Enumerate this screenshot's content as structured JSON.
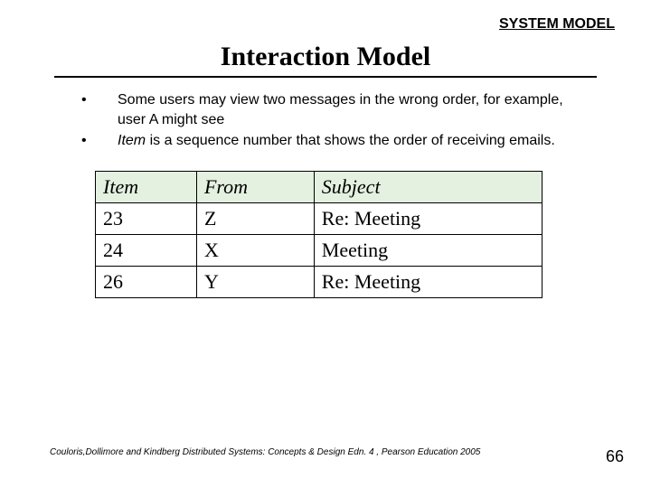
{
  "header": "SYSTEM MODEL",
  "title": "Interaction Model",
  "bullets": [
    {
      "pre": "Some users may view two messages in the wrong order, for example, user A might see"
    },
    {
      "italic_lead": "Item",
      "rest": " is a sequence number that shows the order of receiving emails."
    }
  ],
  "table": {
    "headers": [
      "Item",
      "From",
      "Subject"
    ],
    "rows": [
      [
        "23",
        "Z",
        "Re: Meeting"
      ],
      [
        "24",
        "X",
        "Meeting"
      ],
      [
        "26",
        "Y",
        "Re: Meeting"
      ]
    ]
  },
  "citation": "Couloris,Dollimore and Kindberg  Distributed Systems: Concepts & Design  Edn. 4 , Pearson Education 2005",
  "page_number": "66",
  "chart_data": {
    "type": "table",
    "title": "Interaction Model — email ordering example",
    "columns": [
      "Item",
      "From",
      "Subject"
    ],
    "rows": [
      {
        "Item": 23,
        "From": "Z",
        "Subject": "Re: Meeting"
      },
      {
        "Item": 24,
        "From": "X",
        "Subject": "Meeting"
      },
      {
        "Item": 26,
        "From": "Y",
        "Subject": "Re: Meeting"
      }
    ]
  }
}
